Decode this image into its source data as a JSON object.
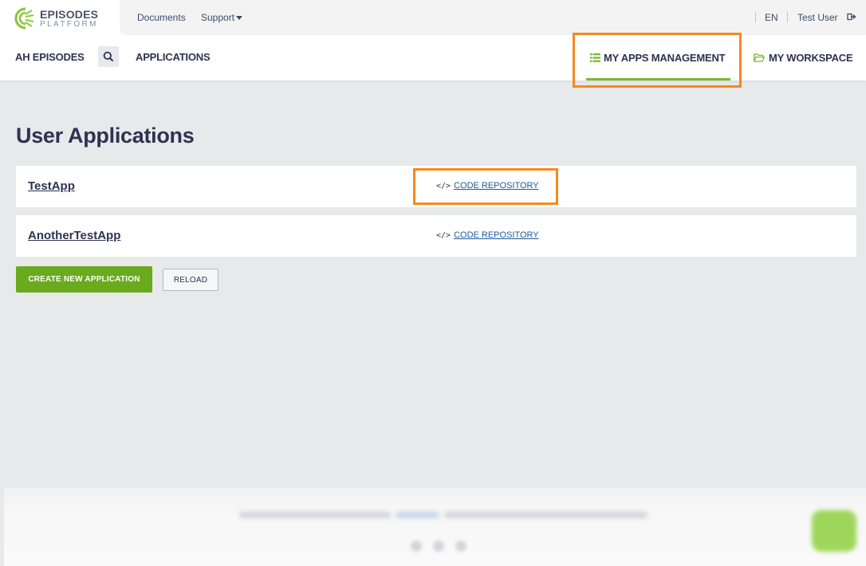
{
  "brand": {
    "title": "EPISODES",
    "subtitle": "PLATFORM"
  },
  "topbar": {
    "documents": "Documents",
    "support": "Support",
    "language": "EN",
    "user": "Test User"
  },
  "nav": {
    "site": "AH EPISODES",
    "applications": "APPLICATIONS",
    "my_apps": "MY APPS MANAGEMENT",
    "workspace": "MY WORKSPACE"
  },
  "page": {
    "title": "User Applications"
  },
  "apps": [
    {
      "name": "TestApp",
      "repo_label": "CODE REPOSITORY"
    },
    {
      "name": "AnotherTestApp",
      "repo_label": "CODE REPOSITORY"
    }
  ],
  "actions": {
    "create": "CREATE NEW APPLICATION",
    "reload": "RELOAD"
  },
  "colors": {
    "accent_green": "#7cb82f",
    "button_green": "#6aaa1e",
    "highlight_orange": "#f5891f",
    "text_navy": "#2d3350",
    "link_blue": "#1a5c9e"
  },
  "icons": {
    "logo": "episodes-logo-icon",
    "search": "search-icon",
    "list": "list-icon",
    "folder": "folder-open-icon",
    "code": "code-icon",
    "logout": "logout-icon"
  }
}
